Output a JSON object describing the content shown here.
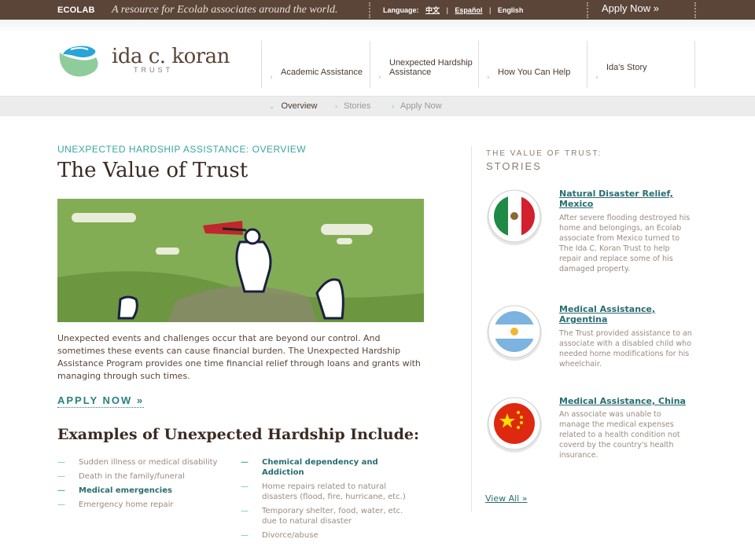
{
  "topbar": {
    "logo": "ECOLAB",
    "tagline": "A resource for Ecolab associates around the world.",
    "language_label": "Language:",
    "lang_chinese": "中文",
    "lang_spanish": "Español",
    "lang_english": "English",
    "apply_now": "Apply Now »"
  },
  "brand": {
    "name": "ida c. koran",
    "sub": "TRUST"
  },
  "nav": [
    {
      "label": "Academic Assistance"
    },
    {
      "label": "Unexpected Hardship Assistance"
    },
    {
      "label": "How You Can Help"
    },
    {
      "label": "Ida's Story"
    }
  ],
  "subnav": [
    {
      "label": "Overview"
    },
    {
      "label": "Stories"
    },
    {
      "label": "Apply Now"
    }
  ],
  "main": {
    "eyebrow": "UNEXPECTED HARDSHIP ASSISTANCE: OVERVIEW",
    "title": "The Value of Trust",
    "intro": "Unexpected events and challenges occur that are beyond our control. And sometimes these events can cause financial burden. The Unexpected Hardship Assistance Program provides one time financial relief through loans and grants with managing through such times.",
    "apply_now": "APPLY NOW »",
    "examples_title": "Examples of Unexpected Hardship Include:",
    "examples_left": [
      {
        "text": "Sudden illness or medical disability",
        "highlight": false
      },
      {
        "text": "Death in the family/funeral",
        "highlight": false
      },
      {
        "text": "Medical emergencies",
        "highlight": true
      },
      {
        "text": "Emergency home repair",
        "highlight": false
      }
    ],
    "examples_right": [
      {
        "text": "Chemical dependency and Addiction",
        "highlight": true
      },
      {
        "text": "Home repairs related to natural disasters (flood, fire, hurricane, etc.)",
        "highlight": false
      },
      {
        "text": "Temporary shelter, food, water, etc. due to natural disaster",
        "highlight": false
      },
      {
        "text": "Divorce/abuse",
        "highlight": false
      }
    ]
  },
  "sidebar": {
    "label": "THE VALUE OF TRUST:",
    "heading": "STORIES",
    "stories": [
      {
        "title": "Natural Disaster Relief, Mexico",
        "text": "After severe flooding destroyed his home and belongings, an Ecolab associate from Mexico turned to The Ida C. Koran Trust to help repair and replace some of his damaged property.",
        "flag": "mexico-flag"
      },
      {
        "title": "Medical Assistance, Argentina",
        "text": "The Trust provided assistance to an associate with a disabled child who needed home modifications for his wheelchair.",
        "flag": "argentina-flag"
      },
      {
        "title": "Medical Assistance, China",
        "text": "An associate was unable to manage the medical expenses related to a health condition not coverd by the country's health insurance.",
        "flag": "china-flag"
      }
    ],
    "view_all": "View All »"
  },
  "colors": {
    "topbar": "#5b4538",
    "accent_teal": "#2a7f80",
    "eyebrow": "#3aa5a5",
    "hero_green": "#7ea84f"
  }
}
